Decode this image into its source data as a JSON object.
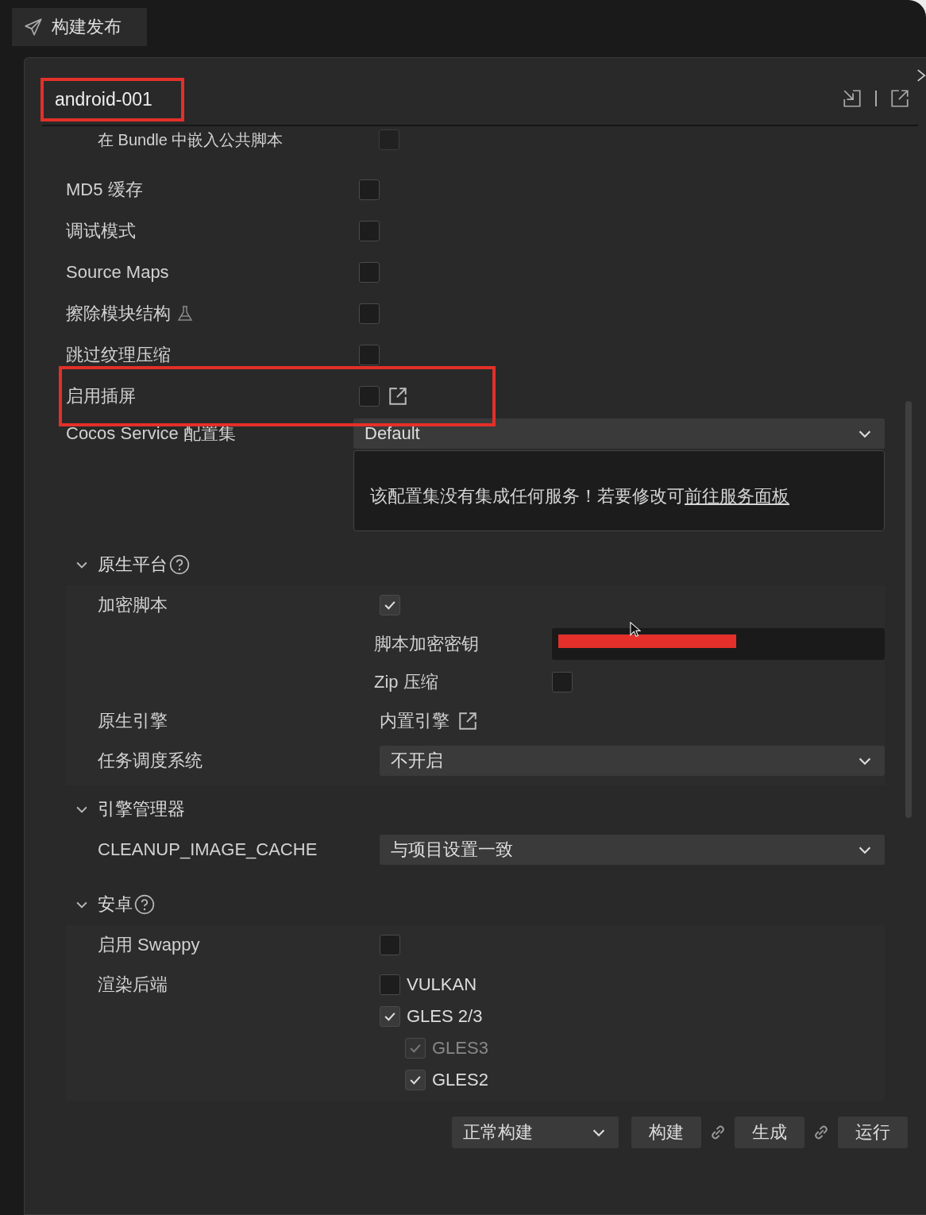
{
  "tab": {
    "title": "构建发布"
  },
  "header": {
    "title": "android-001",
    "highlighted": true
  },
  "clipped_option": {
    "label": "在 Bundle 中嵌入公共脚本",
    "checked": false
  },
  "options": [
    {
      "kind": "checkbox",
      "label": "MD5 缓存",
      "checked": false,
      "experimental": false,
      "link": false,
      "highlighted": false
    },
    {
      "kind": "checkbox",
      "label": "调试模式",
      "checked": false,
      "experimental": false,
      "link": false,
      "highlighted": false
    },
    {
      "kind": "checkbox",
      "label": "Source Maps",
      "checked": false,
      "experimental": false,
      "link": false,
      "highlighted": false
    },
    {
      "kind": "checkbox",
      "label": "擦除模块结构",
      "checked": false,
      "experimental": true,
      "link": false,
      "highlighted": false
    },
    {
      "kind": "checkbox",
      "label": "跳过纹理压缩",
      "checked": false,
      "experimental": false,
      "link": false,
      "highlighted": false
    },
    {
      "kind": "checkbox",
      "label": "启用插屏",
      "checked": false,
      "experimental": false,
      "link": true,
      "highlighted": true
    },
    {
      "kind": "select",
      "label": "Cocos Service 配置集",
      "value": "Default",
      "note": "该配置集没有集成任何服务！若要修改可",
      "link_text": "前往服务面板"
    }
  ],
  "sections": [
    {
      "title": "原生平台",
      "expanded": true,
      "help": true,
      "rows": [
        {
          "kind": "checkbox",
          "label": "加密脚本",
          "checked": true,
          "children": [
            {
              "kind": "secret",
              "label": "脚本加密密钥",
              "redacted": true
            },
            {
              "kind": "checkbox",
              "label": "Zip 压缩",
              "checked": false
            }
          ]
        },
        {
          "kind": "link",
          "label": "原生引擎",
          "value": "内置引擎"
        },
        {
          "kind": "select",
          "label": "任务调度系统",
          "value": "不开启"
        }
      ]
    },
    {
      "title": "引擎管理器",
      "expanded": true,
      "help": false,
      "rows": [
        {
          "kind": "select",
          "label": "CLEANUP_IMAGE_CACHE",
          "value": "与项目设置一致"
        }
      ]
    },
    {
      "title": "安卓",
      "expanded": true,
      "help": true,
      "rows": [
        {
          "kind": "checkbox",
          "label": "启用 Swappy",
          "checked": false
        },
        {
          "kind": "checklist",
          "label": "渲染后端",
          "options": [
            {
              "label": "VULKAN",
              "checked": false,
              "disabled": false
            },
            {
              "label": "GLES 2/3",
              "checked": true,
              "disabled": false,
              "children": [
                {
                  "label": "GLES3",
                  "checked": true,
                  "disabled": true
                },
                {
                  "label": "GLES2",
                  "checked": true,
                  "disabled": false
                }
              ]
            }
          ]
        }
      ]
    }
  ],
  "footer": {
    "mode": "正常构建",
    "buttons": [
      {
        "label": "构建",
        "linked": true
      },
      {
        "label": "生成",
        "linked": true
      },
      {
        "label": "运行",
        "linked": false
      }
    ]
  }
}
